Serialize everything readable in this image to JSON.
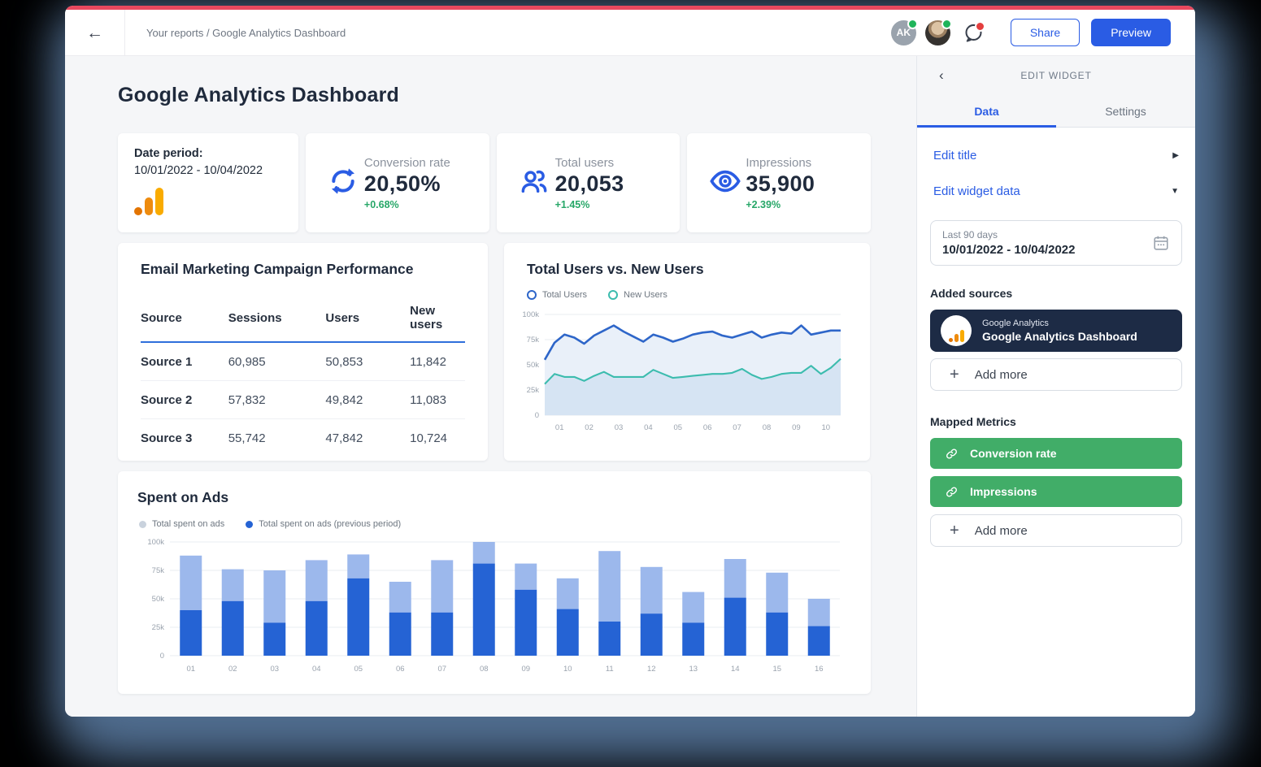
{
  "topbar": {
    "breadcrumb": "Your reports / Google Analytics Dashboard",
    "avatar_initials": "AK",
    "share_label": "Share",
    "preview_label": "Preview"
  },
  "page": {
    "title": "Google Analytics Dashboard"
  },
  "kpis": {
    "date_period": {
      "label": "Date period:",
      "value": "10/01/2022 - 10/04/2022"
    },
    "cards": [
      {
        "label": "Conversion rate",
        "value": "20,50%",
        "delta": "+0.68%",
        "icon": "refresh-icon"
      },
      {
        "label": "Total users",
        "value": "20,053",
        "delta": "+1.45%",
        "icon": "users-icon"
      },
      {
        "label": "Impressions",
        "value": "35,900",
        "delta": "+2.39%",
        "icon": "eye-icon"
      }
    ]
  },
  "table": {
    "title": "Email Marketing Campaign Performance",
    "headers": [
      "Source",
      "Sessions",
      "Users",
      "New users"
    ],
    "rows": [
      [
        "Source 1",
        "60,985",
        "50,853",
        "11,842"
      ],
      [
        "Source 2",
        "57,832",
        "49,842",
        "11,083"
      ],
      [
        "Source 3",
        "55,742",
        "47,842",
        "10,724"
      ]
    ]
  },
  "chart_data": [
    {
      "type": "area",
      "title": "Total Users vs. New Users",
      "ylim": [
        0,
        100000
      ],
      "yticks": [
        0,
        25000,
        50000,
        75000,
        100000
      ],
      "ytick_labels": [
        "0",
        "25k",
        "50k",
        "75k",
        "100k"
      ],
      "x_labels": [
        "01",
        "02",
        "03",
        "04",
        "05",
        "06",
        "07",
        "08",
        "09",
        "10"
      ],
      "grid": true,
      "legend_position": "top",
      "series": [
        {
          "name": "Total Users",
          "color": "#2e66c9",
          "fill": "#e9f0f9",
          "values": [
            55000,
            72000,
            80000,
            77000,
            71000,
            79000,
            84000,
            89000,
            83000,
            78000,
            73000,
            80000,
            77000,
            73000,
            76000,
            80000,
            82000,
            83000,
            79000,
            77000,
            80000,
            83000,
            77000,
            80000,
            82000,
            81000,
            89000,
            80000,
            82000,
            84000,
            84000
          ]
        },
        {
          "name": "New Users",
          "color": "#3cbcae",
          "fill": "#d6e4f3",
          "values": [
            31000,
            41000,
            38000,
            38000,
            34000,
            39000,
            43000,
            38000,
            38000,
            38000,
            38000,
            45000,
            41000,
            37000,
            38000,
            39000,
            40000,
            41000,
            41000,
            42000,
            46000,
            40000,
            36000,
            38000,
            41000,
            42000,
            42000,
            49000,
            41000,
            47000,
            56000
          ]
        }
      ]
    },
    {
      "type": "bar",
      "title": "Spent on Ads",
      "stacked": true,
      "ylim": [
        0,
        100000
      ],
      "yticks": [
        0,
        25000,
        50000,
        75000,
        100000
      ],
      "ytick_labels": [
        "0",
        "25k",
        "50k",
        "75k",
        "100k"
      ],
      "categories": [
        "01",
        "02",
        "03",
        "04",
        "05",
        "06",
        "07",
        "08",
        "09",
        "10",
        "11",
        "12",
        "13",
        "14",
        "15",
        "16"
      ],
      "grid": true,
      "legend_position": "top",
      "series": [
        {
          "name": "Total spent on ads",
          "color": "#9cb8ec",
          "legend_color": "#c9d2dd",
          "values": [
            48000,
            28000,
            46000,
            36000,
            21000,
            27000,
            46000,
            19000,
            23000,
            27000,
            62000,
            41000,
            27000,
            34000,
            35000,
            24000
          ]
        },
        {
          "name": "Total spent on ads (previous period)",
          "color": "#2563d4",
          "values": [
            40000,
            48000,
            29000,
            48000,
            68000,
            38000,
            38000,
            81000,
            58000,
            41000,
            30000,
            37000,
            29000,
            51000,
            38000,
            26000
          ]
        }
      ]
    }
  ],
  "sidebar": {
    "header": "EDIT WIDGET",
    "tabs": [
      {
        "label": "Data",
        "active": true
      },
      {
        "label": "Settings",
        "active": false
      }
    ],
    "edit_title_label": "Edit title",
    "edit_widget_data_label": "Edit widget data",
    "date_range": {
      "label": "Last 90 days",
      "value": "10/01/2022 - 10/04/2022"
    },
    "added_sources_label": "Added sources",
    "source": {
      "type": "Google Analytics",
      "name": "Google Analytics Dashboard"
    },
    "add_more_label": "Add more",
    "mapped_metrics_label": "Mapped Metrics",
    "metrics": [
      "Conversion rate",
      "Impressions"
    ]
  },
  "colors": {
    "accent_blue": "#2a5ce4",
    "top_strip_red": "#e8485e",
    "positive_green": "#27a768",
    "metric_button_green": "#41ad68",
    "navy_card": "#1d2b45",
    "ga_orange": "#e37400",
    "ga_amber": "#f9ab00",
    "canvas_gray": "#f5f6f8"
  }
}
